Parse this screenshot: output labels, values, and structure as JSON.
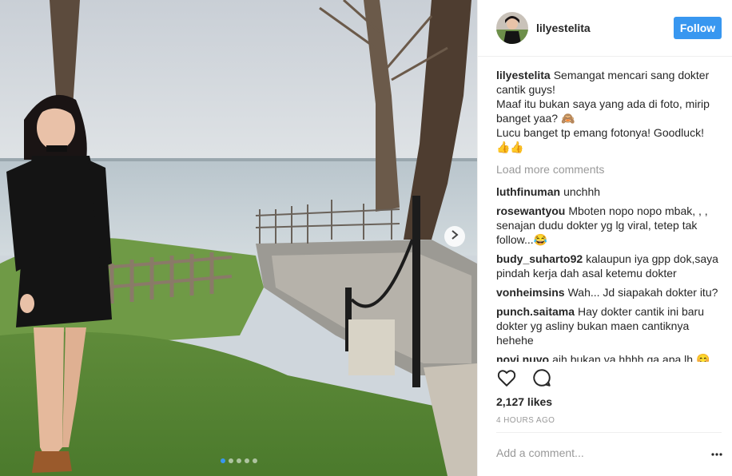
{
  "header": {
    "username": "lilyestelita",
    "follow_label": "Follow"
  },
  "caption": {
    "username": "lilyestelita",
    "text": "Semangat mencari sang dokter cantik guys!\nMaaf itu bukan saya yang ada di foto, mirip banget yaa? 🙈\nLucu banget tp emang fotonya! Goodluck! 👍👍"
  },
  "load_more_label": "Load more comments",
  "comments": [
    {
      "username": "luthfinuman",
      "text": "unchhh"
    },
    {
      "username": "rosewantyou",
      "text": "Mboten nopo nopo mbak, , , senajan dudu dokter yg lg viral, tetep tak follow...😂"
    },
    {
      "username": "budy_suharto92",
      "text": "kalaupun iya gpp dok,saya pindah kerja dah asal ketemu dokter"
    },
    {
      "username": "vonheimsins",
      "text": "Wah... Jd siapakah dokter itu?"
    },
    {
      "username": "punch.saitama",
      "text": "Hay dokter cantik ini baru dokter yg asliny bukan maen cantiknya hehehe"
    },
    {
      "username": "novi.nuvo",
      "text": "aih bukan ya hhhh ga apa lh 😊"
    }
  ],
  "likes": "2,127 likes",
  "time_ago": "4 HOURS AGO",
  "comment_input": {
    "placeholder": "Add a comment..."
  },
  "carousel": {
    "count": 5,
    "active_index": 0
  },
  "icons": {
    "like": "heart-icon",
    "comment": "speech-bubble-icon",
    "next": "chevron-right-icon",
    "more": "ellipsis-icon"
  },
  "colors": {
    "accent": "#3897f0",
    "muted": "#999999",
    "text": "#262626",
    "border": "#efefef"
  }
}
